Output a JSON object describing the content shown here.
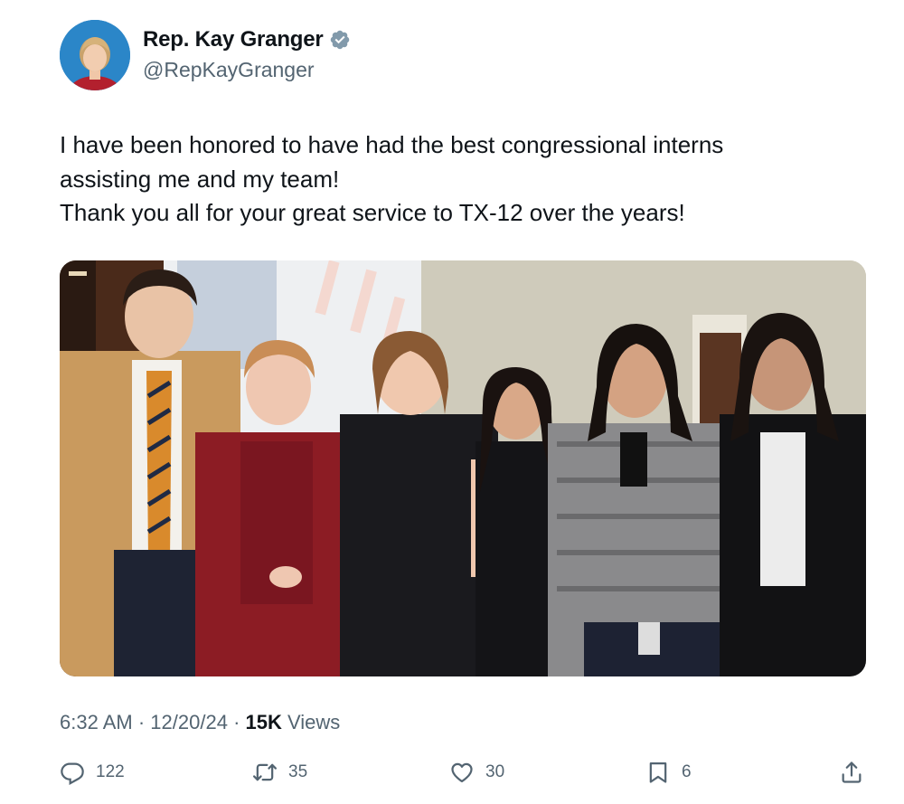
{
  "author": {
    "name": "Rep. Kay Granger",
    "handle": "@RepKayGranger",
    "verified": true
  },
  "tweet": {
    "lines": [
      "I have been honored to have had the best congressional interns",
      "assisting me and my team!",
      "Thank you all for your great service to TX-12 over the years!"
    ]
  },
  "meta": {
    "time": "6:32 AM",
    "date": "12/20/24",
    "separator": "·",
    "views_count": "15K",
    "views_label": "Views"
  },
  "actions": {
    "replies": "122",
    "reposts": "35",
    "likes": "30",
    "bookmarks": "6"
  },
  "colors": {
    "text_primary": "#0f1419",
    "text_secondary": "#536471",
    "verified_badge": "#829aab"
  },
  "icons": [
    "verified-badge-icon",
    "reply-icon",
    "repost-icon",
    "like-icon",
    "bookmark-icon",
    "share-icon"
  ]
}
